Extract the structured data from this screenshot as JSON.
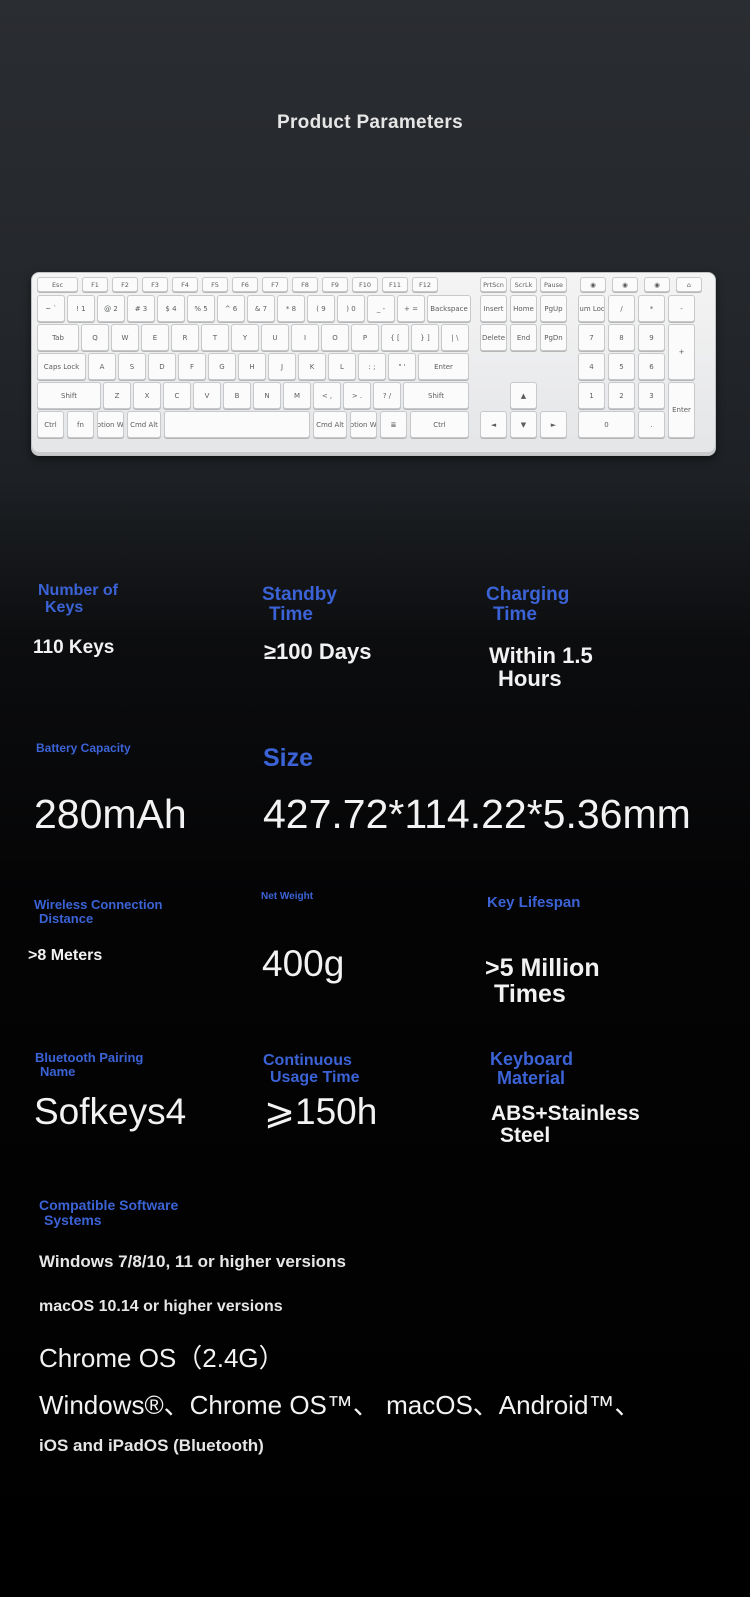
{
  "page": {
    "title": "Product Parameters"
  },
  "keyboard": {
    "fn_row": [
      "Esc",
      "F1",
      "F2",
      "F3",
      "F4",
      "F5",
      "F6",
      "F7",
      "F8",
      "F9",
      "F10",
      "F11",
      "F12",
      "PrtScn",
      "ScrLk",
      "Pause"
    ],
    "row1": [
      "~ `",
      "! 1",
      "@ 2",
      "# 3",
      "$ 4",
      "% 5",
      "^ 6",
      "& 7",
      "* 8",
      "( 9",
      ") 0",
      "_ -",
      "+ =",
      "Backspace",
      "Insert",
      "Home",
      "PgUp",
      "Num Lock",
      "/",
      "*",
      "-"
    ],
    "row2": [
      "Tab",
      "Q",
      "W",
      "E",
      "R",
      "T",
      "Y",
      "U",
      "I",
      "O",
      "P",
      "{ [",
      "} ]",
      "| \\",
      "Delete",
      "End",
      "PgDn",
      "7",
      "8",
      "9",
      "+"
    ],
    "row3": [
      "Caps Lock",
      "A",
      "S",
      "D",
      "F",
      "G",
      "H",
      "J",
      "K",
      "L",
      ": ;",
      "\" '",
      "Enter",
      "4",
      "5",
      "6"
    ],
    "row4": [
      "Shift",
      "Z",
      "X",
      "C",
      "V",
      "B",
      "N",
      "M",
      "< ,",
      "> .",
      "? /",
      "Shift",
      "▲",
      "1",
      "2",
      "3",
      "Enter"
    ],
    "row5": [
      "Ctrl",
      "fn",
      "Option Win",
      "Cmd Alt",
      "",
      "Cmd Alt",
      "Option Win",
      "≣",
      "Ctrl",
      "◄",
      "▼",
      "►",
      "0",
      "."
    ]
  },
  "specs": {
    "keys": {
      "label_1": "Number of",
      "label_2": "Keys",
      "value": "110 Keys"
    },
    "standby": {
      "label_1": "Standby",
      "label_2": "Time",
      "value": "≥100 Days"
    },
    "charging": {
      "label_1": "Charging",
      "label_2": "Time",
      "value_1": "Within 1.5",
      "value_2": "Hours"
    },
    "battery": {
      "label": "Battery Capacity",
      "value": "280mAh"
    },
    "size": {
      "label": "Size",
      "value": "427.72*114.22*5.36mm"
    },
    "wireless": {
      "label_1": "Wireless Connection",
      "label_2": "Distance",
      "value": ">8 Meters"
    },
    "weight": {
      "label": "Net Weight",
      "value": "400g"
    },
    "lifespan": {
      "label": "Key Lifespan",
      "value_1": ">5 Million",
      "value_2": "Times"
    },
    "bt_name": {
      "label_1": "Bluetooth Pairing",
      "label_2": "Name",
      "value": "Sofkeys4"
    },
    "usage": {
      "label_1": "Continuous",
      "label_2": "Usage Time",
      "value": "⩾150h"
    },
    "material": {
      "label_1": "Keyboard",
      "label_2": "Material",
      "value_1": "ABS+Stainless",
      "value_2": "Steel"
    }
  },
  "compat": {
    "label_1": "Compatible Software",
    "label_2": "Systems",
    "line1": "Windows 7/8/10, 11 or higher versions",
    "line2": "macOS 10.14 or higher versions",
    "line3": "Chrome OS（2.4G）",
    "line4": "Windows®、Chrome OS™、 macOS、Android™、",
    "line5": "iOS and iPadOS (Bluetooth)"
  },
  "colors": {
    "label_blue": "#3b63d6",
    "value_white": "#f2f2f2",
    "keyboard_silver": "#e4e5e7"
  }
}
